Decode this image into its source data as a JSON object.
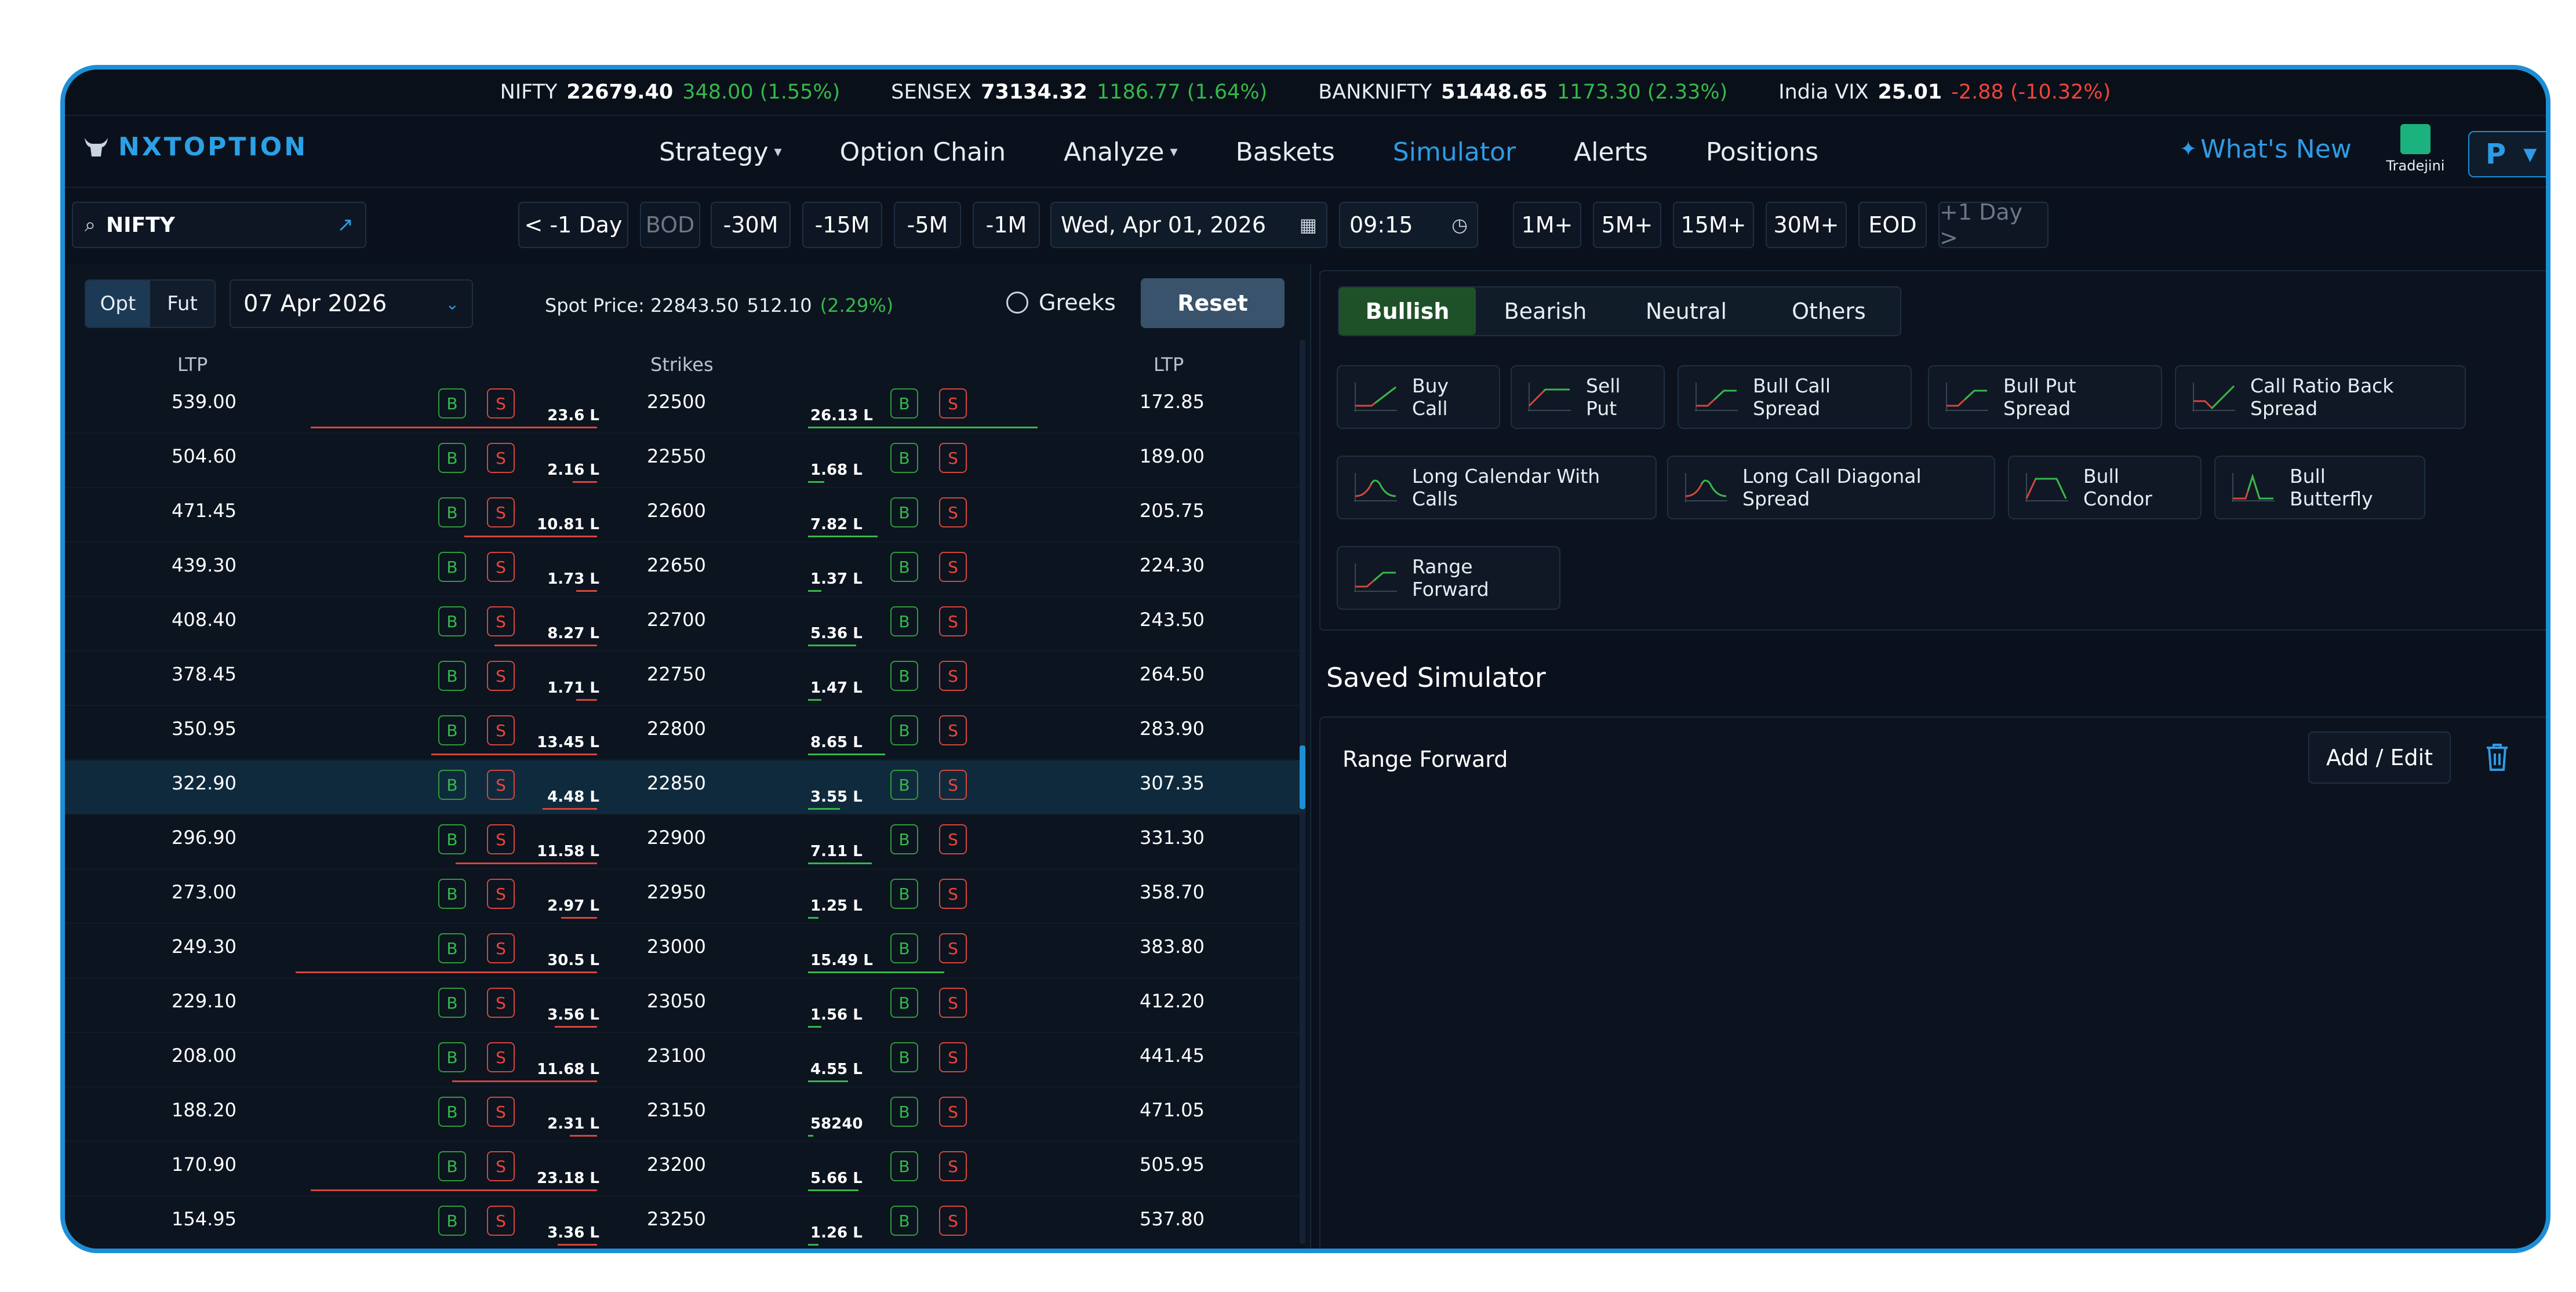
{
  "ticker": [
    {
      "name": "NIFTY",
      "value": "22679.40",
      "change": "348.00 (1.55%)",
      "dir": "up"
    },
    {
      "name": "SENSEX",
      "value": "73134.32",
      "change": "1186.77 (1.64%)",
      "dir": "up"
    },
    {
      "name": "BANKNIFTY",
      "value": "51448.65",
      "change": "1173.30 (2.33%)",
      "dir": "up"
    },
    {
      "name": "India VIX",
      "value": "25.01",
      "change": "-2.88 (-10.32%)",
      "dir": "down"
    }
  ],
  "brand": {
    "logo_text": "NXTOPTION"
  },
  "nav": {
    "strategy": "Strategy",
    "option_chain": "Option Chain",
    "analyze": "Analyze",
    "baskets": "Baskets",
    "simulator": "Simulator",
    "alerts": "Alerts",
    "positions": "Positions",
    "whats_new": "What's New",
    "broker": "Tradejini",
    "profile": "P"
  },
  "toolbar": {
    "symbol": "NIFTY",
    "minus_day": "< -1 Day",
    "bod": "BOD",
    "m30": "-30M",
    "m15": "-15M",
    "m5": "-5M",
    "m1": "-1M",
    "date": "Wed, Apr 01, 2026",
    "time": "09:15",
    "p1": "1M+",
    "p5": "5M+",
    "p15": "15M+",
    "p30": "30M+",
    "eod": "EOD",
    "plus_day": "+1 Day >"
  },
  "chain": {
    "opt": "Opt",
    "fut": "Fut",
    "expiry": "07 Apr 2026",
    "spot_label": "Spot Price: 22843.50",
    "spot_change": "512.10",
    "spot_pct": "(2.29%)",
    "greeks": "Greeks",
    "reset": "Reset",
    "col_ltp_call": "LTP",
    "col_strikes": "Strikes",
    "col_ltp_put": "LTP",
    "buy": "B",
    "sell": "S",
    "rows": [
      {
        "call_ltp": "539.00",
        "call_oi": "23.6 L",
        "call_bar": 0.95,
        "strike": "22500",
        "put_oi": "26.13 L",
        "put_bar": 0.86,
        "put_ltp": "172.85"
      },
      {
        "call_ltp": "504.60",
        "call_oi": "2.16 L",
        "call_bar": 0.08,
        "strike": "22550",
        "put_oi": "1.68 L",
        "put_bar": 0.06,
        "put_ltp": "189.00"
      },
      {
        "call_ltp": "471.45",
        "call_oi": "10.81 L",
        "call_bar": 0.44,
        "strike": "22600",
        "put_oi": "7.82 L",
        "put_bar": 0.26,
        "put_ltp": "205.75"
      },
      {
        "call_ltp": "439.30",
        "call_oi": "1.73 L",
        "call_bar": 0.07,
        "strike": "22650",
        "put_oi": "1.37 L",
        "put_bar": 0.05,
        "put_ltp": "224.30"
      },
      {
        "call_ltp": "408.40",
        "call_oi": "8.27 L",
        "call_bar": 0.34,
        "strike": "22700",
        "put_oi": "5.36 L",
        "put_bar": 0.18,
        "put_ltp": "243.50"
      },
      {
        "call_ltp": "378.45",
        "call_oi": "1.71 L",
        "call_bar": 0.07,
        "strike": "22750",
        "put_oi": "1.47 L",
        "put_bar": 0.05,
        "put_ltp": "264.50"
      },
      {
        "call_ltp": "350.95",
        "call_oi": "13.45 L",
        "call_bar": 0.55,
        "strike": "22800",
        "put_oi": "8.65 L",
        "put_bar": 0.29,
        "put_ltp": "283.90"
      },
      {
        "call_ltp": "322.90",
        "call_oi": "4.48 L",
        "call_bar": 0.18,
        "strike": "22850",
        "put_oi": "3.55 L",
        "put_bar": 0.12,
        "put_ltp": "307.35",
        "highlight": true
      },
      {
        "call_ltp": "296.90",
        "call_oi": "11.58 L",
        "call_bar": 0.47,
        "strike": "22900",
        "put_oi": "7.11 L",
        "put_bar": 0.24,
        "put_ltp": "331.30"
      },
      {
        "call_ltp": "273.00",
        "call_oi": "2.97 L",
        "call_bar": 0.12,
        "strike": "22950",
        "put_oi": "1.25 L",
        "put_bar": 0.04,
        "put_ltp": "358.70"
      },
      {
        "call_ltp": "249.30",
        "call_oi": "30.5 L",
        "call_bar": 1.0,
        "strike": "23000",
        "put_oi": "15.49 L",
        "put_bar": 0.51,
        "put_ltp": "383.80"
      },
      {
        "call_ltp": "229.10",
        "call_oi": "3.56 L",
        "call_bar": 0.14,
        "strike": "23050",
        "put_oi": "1.56 L",
        "put_bar": 0.05,
        "put_ltp": "412.20"
      },
      {
        "call_ltp": "208.00",
        "call_oi": "11.68 L",
        "call_bar": 0.48,
        "strike": "23100",
        "put_oi": "4.55 L",
        "put_bar": 0.15,
        "put_ltp": "441.45"
      },
      {
        "call_ltp": "188.20",
        "call_oi": "2.31 L",
        "call_bar": 0.09,
        "strike": "23150",
        "put_oi": "58240",
        "put_bar": 0.02,
        "put_ltp": "471.05"
      },
      {
        "call_ltp": "170.90",
        "call_oi": "23.18 L",
        "call_bar": 0.95,
        "strike": "23200",
        "put_oi": "5.66 L",
        "put_bar": 0.19,
        "put_ltp": "505.95"
      },
      {
        "call_ltp": "154.95",
        "call_oi": "3.36 L",
        "call_bar": 0.13,
        "strike": "23250",
        "put_oi": "1.26 L",
        "put_bar": 0.04,
        "put_ltp": "537.80"
      }
    ]
  },
  "strategies": {
    "tabs": [
      "Bullish",
      "Bearish",
      "Neutral",
      "Others"
    ],
    "active_tab": "Bullish",
    "items": [
      {
        "label": "Buy Call",
        "icon": "payoff-buy-call-icon"
      },
      {
        "label": "Sell Put",
        "icon": "payoff-sell-put-icon"
      },
      {
        "label": "Bull Call Spread",
        "icon": "payoff-bull-call-spread-icon"
      },
      {
        "label": "Bull Put Spread",
        "icon": "payoff-bull-put-spread-icon"
      },
      {
        "label": "Call Ratio Back Spread",
        "icon": "payoff-call-ratio-back-spread-icon"
      },
      {
        "label": "Long Calendar With Calls",
        "icon": "payoff-long-calendar-icon"
      },
      {
        "label": "Long Call Diagonal Spread",
        "icon": "payoff-long-call-diagonal-icon"
      },
      {
        "label": "Bull Condor",
        "icon": "payoff-bull-condor-icon"
      },
      {
        "label": "Bull Butterfly",
        "icon": "payoff-bull-butterfly-icon"
      },
      {
        "label": "Range Forward",
        "icon": "payoff-range-forward-icon"
      }
    ]
  },
  "saved": {
    "title": "Saved Simulator",
    "items": [
      {
        "name": "Range Forward",
        "action": "Add / Edit"
      }
    ]
  },
  "colors": {
    "accent": "#2e9be6",
    "up": "#35b84a",
    "down": "#f0443a",
    "border": "#1d8fd6"
  }
}
